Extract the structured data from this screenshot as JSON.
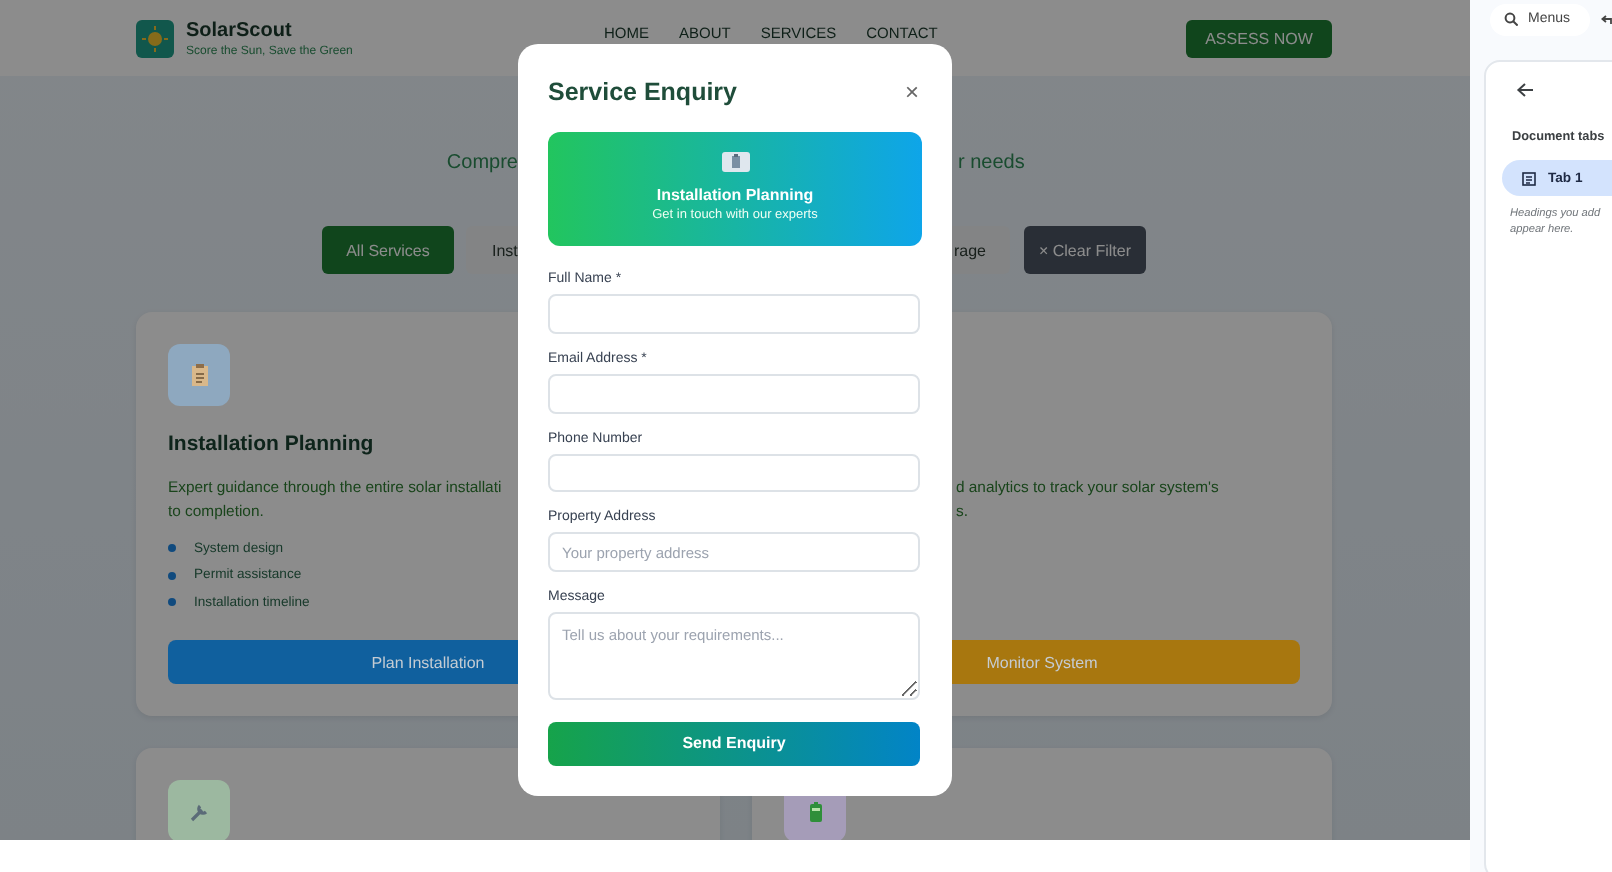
{
  "header": {
    "brand": "SolarScout",
    "tagline": "Score the Sun, Save the Green",
    "nav": [
      {
        "label": "HOME"
      },
      {
        "label": "ABOUT"
      },
      {
        "label": "SERVICES"
      },
      {
        "label": "CONTACT"
      }
    ],
    "cta": "ASSESS NOW"
  },
  "hero": {
    "subtitle_left": "Compre",
    "subtitle_right": "r needs"
  },
  "filters": [
    {
      "label": "All Services",
      "selected": true,
      "kind": "filter"
    },
    {
      "label": "Inst",
      "selected": false,
      "kind": "filter"
    },
    {
      "label": "rage",
      "selected": false,
      "kind": "filter"
    },
    {
      "label": "× Clear Filter",
      "kind": "clear"
    }
  ],
  "cards": [
    {
      "color": "#8ea8bf",
      "title": "Installation Planning",
      "description_lines": [
        "Expert guidance through the entire solar installati",
        "to completion."
      ],
      "features": [
        "System design",
        "Permit assistance",
        "Installation timeline"
      ],
      "button": {
        "label": "Plan Installation",
        "color": "#10609e"
      }
    },
    {
      "description_lines": [
        "d analytics to track your solar system's",
        "s."
      ],
      "button": {
        "label": "Monitor System",
        "color": "#a8770f"
      }
    },
    {
      "color": "#9cb8a0"
    },
    {
      "color": "#a59cb8"
    }
  ],
  "modal": {
    "title": "Service Enquiry",
    "close": "×",
    "banner": {
      "title": "Installation Planning",
      "subtitle": "Get in touch with our experts"
    },
    "fields": [
      {
        "label": "Full Name *",
        "kind": "input"
      },
      {
        "label": "Email Address *",
        "kind": "input"
      },
      {
        "label": "Phone Number",
        "kind": "input"
      },
      {
        "label": "Property Address",
        "placeholder": "Your property address",
        "kind": "input"
      },
      {
        "label": "Message",
        "placeholder": "Tell us about your requirements...",
        "kind": "textarea"
      }
    ],
    "submit": "Send Enquiry"
  },
  "side_panel": {
    "search": "Menus",
    "heading": "Document tabs",
    "tabs": [
      {
        "label": "Tab 1",
        "selected": true
      }
    ],
    "hint": "Headings you add appear here."
  }
}
